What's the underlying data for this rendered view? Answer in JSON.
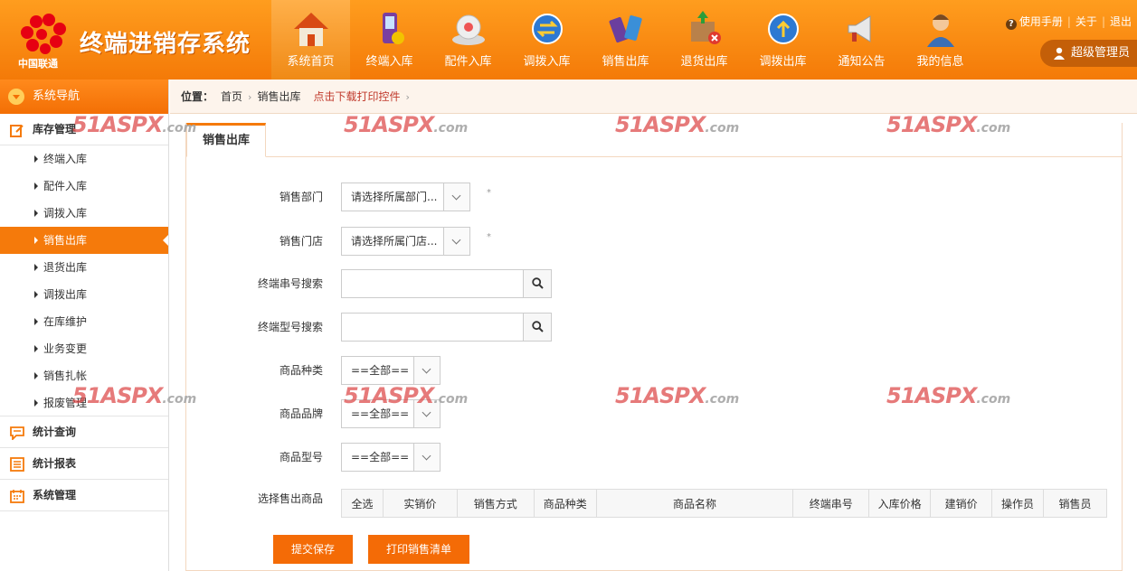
{
  "app": {
    "title": "终端进销存系统",
    "logo_caption": "中国联通"
  },
  "nav": [
    {
      "label": "系统首页",
      "icon": "house-icon",
      "active": true
    },
    {
      "label": "终端入库",
      "icon": "phone-icon"
    },
    {
      "label": "配件入库",
      "icon": "router-icon"
    },
    {
      "label": "调拨入库",
      "icon": "swap-globe-icon"
    },
    {
      "label": "销售出库",
      "icon": "phones-icon"
    },
    {
      "label": "退货出库",
      "icon": "box-cancel-icon"
    },
    {
      "label": "调拨出库",
      "icon": "upload-globe-icon"
    },
    {
      "label": "通知公告",
      "icon": "megaphone-icon"
    },
    {
      "label": "我的信息",
      "icon": "user-icon"
    }
  ],
  "toplinks": {
    "help": "使用手册",
    "about": "关于",
    "logout": "退出"
  },
  "user": {
    "name": "超级管理员"
  },
  "sidebar": {
    "title": "系统导航",
    "groups": [
      {
        "label": "库存管理",
        "icon": "edit-icon",
        "items": [
          {
            "label": "终端入库"
          },
          {
            "label": "配件入库"
          },
          {
            "label": "调拨入库"
          },
          {
            "label": "销售出库",
            "active": true
          },
          {
            "label": "退货出库"
          },
          {
            "label": "调拨出库"
          },
          {
            "label": "在库维护"
          },
          {
            "label": "业务变更"
          },
          {
            "label": "销售扎帐"
          },
          {
            "label": "报废管理"
          }
        ]
      },
      {
        "label": "统计查询",
        "icon": "chat-icon"
      },
      {
        "label": "统计报表",
        "icon": "list-icon"
      },
      {
        "label": "系统管理",
        "icon": "calendar-icon"
      }
    ]
  },
  "breadcrumb": {
    "lead": "位置：",
    "home": "首页",
    "current": "销售出库",
    "download": "点击下载打印控件"
  },
  "tab": {
    "label": "销售出库"
  },
  "form": {
    "dept": {
      "label": "销售部门",
      "value": "请选择所属部门..."
    },
    "store": {
      "label": "销售门店",
      "value": "请选择所属门店..."
    },
    "required_mark": "*",
    "serial_search": {
      "label": "终端串号搜索",
      "value": ""
    },
    "model_search": {
      "label": "终端型号搜索",
      "value": ""
    },
    "category": {
      "label": "商品种类",
      "value": "==全部=="
    },
    "brand": {
      "label": "商品品牌",
      "value": "==全部=="
    },
    "model": {
      "label": "商品型号",
      "value": "==全部=="
    },
    "select_goods": {
      "label": "选择售出商品"
    }
  },
  "table": {
    "headers": [
      "全选",
      "实销价",
      "销售方式",
      "商品种类",
      "商品名称",
      "终端串号",
      "入库价格",
      "建销价",
      "操作员",
      "销售员"
    ],
    "rows": []
  },
  "buttons": {
    "submit": "提交保存",
    "print": "打印销售清单"
  },
  "watermark": {
    "main": "51ASPX",
    "suffix": ".com"
  },
  "colors": {
    "brand_orange": "#f57a0b",
    "header_orange": "#ff9d1e",
    "link_red": "#c0392b"
  }
}
